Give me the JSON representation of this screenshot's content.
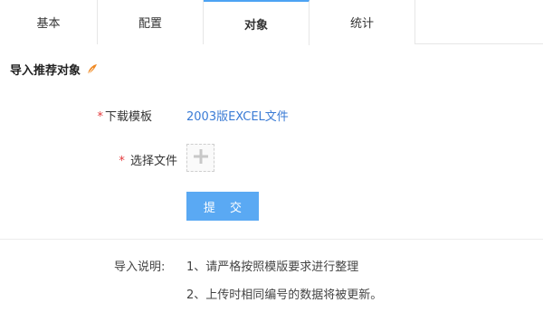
{
  "tabs": [
    {
      "label": "基本"
    },
    {
      "label": "配置"
    },
    {
      "label": "对象"
    },
    {
      "label": "统计"
    }
  ],
  "active_tab": "对象",
  "section": {
    "title": "导入推荐对象",
    "icon": "feather-icon"
  },
  "form": {
    "template": {
      "required_mark": "*",
      "label": "下载模板",
      "link_text": "2003版EXCEL文件"
    },
    "file": {
      "required_mark": "*",
      "label": " 选择文件",
      "upload_icon": "plus-icon"
    },
    "submit_label": "提 交"
  },
  "notes": {
    "label": "导入说明:",
    "items": [
      "1、请严格按照模版要求进行整理",
      "2、上传时相同编号的数据将被更新。"
    ]
  },
  "colors": {
    "accent": "#4da3f3",
    "button": "#5aa9f3",
    "link": "#3a7bd5",
    "required": "#e4393c",
    "feather": "#f08a24"
  }
}
